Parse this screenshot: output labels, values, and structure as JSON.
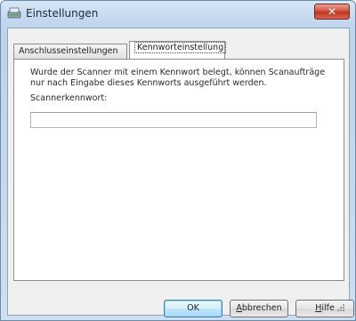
{
  "window": {
    "title": "Einstellungen",
    "close_label": "✕"
  },
  "tabs": [
    {
      "label": "Anschlusseinstellungen",
      "selected": false
    },
    {
      "label": "Kennworteinstellung",
      "selected": true
    }
  ],
  "password_panel": {
    "description": "Wurde der Scanner mit einem Kennwort belegt, können Scanaufträge nur nach Eingabe dieses Kennworts ausgeführt werden.",
    "field_label": "Scannerkennwort:",
    "field_value": ""
  },
  "buttons": {
    "ok": "OK",
    "cancel_prefix": "",
    "cancel_access_key": "A",
    "cancel_rest": "bbrechen",
    "help_access_key": "H",
    "help_rest": "ilfe"
  },
  "colors": {
    "titlebar": "#c3d8ee",
    "client_background": "#f0f0f0",
    "close_button": "#c0331f",
    "default_button_border": "#3c7fb1"
  }
}
